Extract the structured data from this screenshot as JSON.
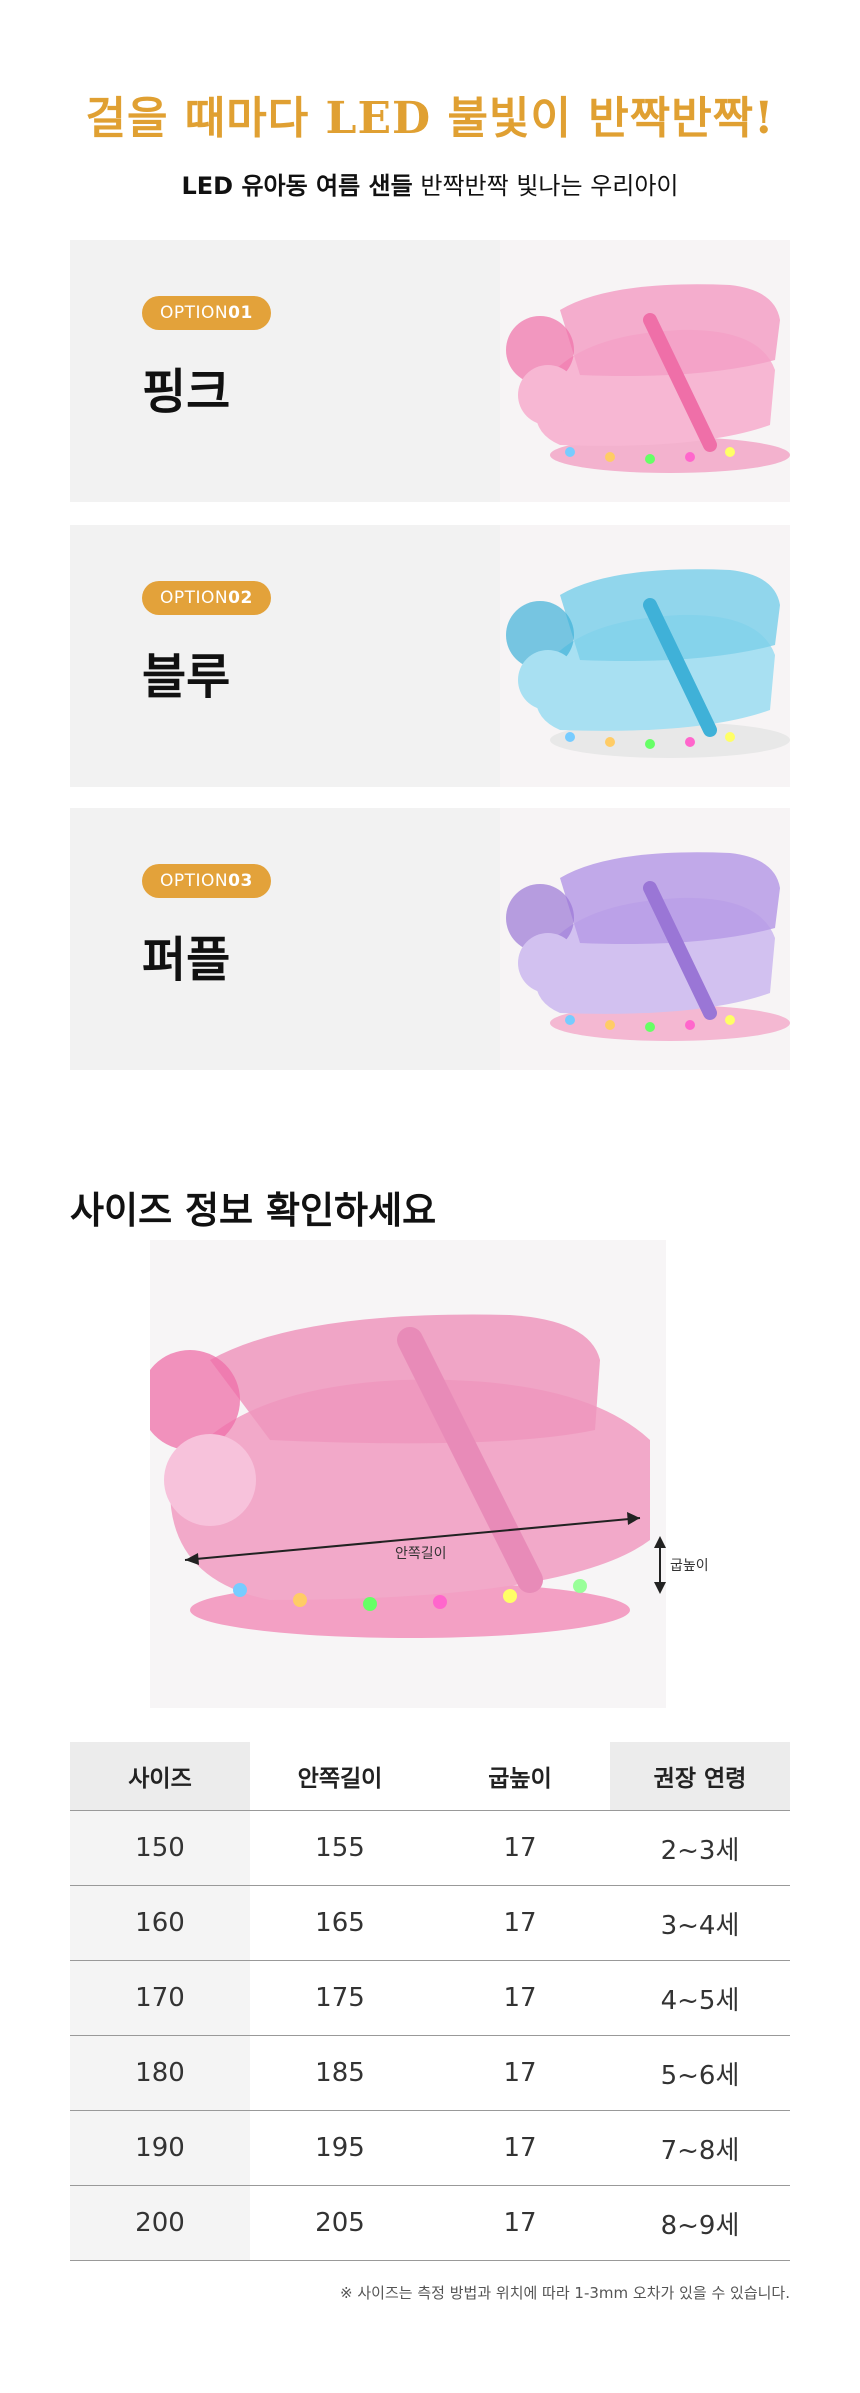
{
  "headline": "걸을 때마다 LED 불빛이 반짝반짝!",
  "subline": {
    "bold": "LED 유아동 여름 샌들",
    "regular": "반짝반짝 빛나는 우리아이"
  },
  "options": [
    {
      "badge_prefix": "OPTION",
      "badge_num": "01",
      "name": "핑크",
      "color": "#ef6fa8",
      "accent": "#f7b7d3"
    },
    {
      "badge_prefix": "OPTION",
      "badge_num": "02",
      "name": "블루",
      "color": "#3fb1d8",
      "accent": "#a8e0f2"
    },
    {
      "badge_prefix": "OPTION",
      "badge_num": "03",
      "name": "퍼플",
      "color": "#9a76d6",
      "accent": "#d2c1f0"
    }
  ],
  "size_section": {
    "title": "사이즈 정보 확인하세요",
    "inner_length_label": "안쪽길이",
    "heel_height_label": "굽높이"
  },
  "size_table": {
    "headers": [
      "사이즈",
      "안쪽길이",
      "굽높이",
      "권장 연령"
    ],
    "rows": [
      [
        "150",
        "155",
        "17",
        "2~3세"
      ],
      [
        "160",
        "165",
        "17",
        "3~4세"
      ],
      [
        "170",
        "175",
        "17",
        "4~5세"
      ],
      [
        "180",
        "185",
        "17",
        "5~6세"
      ],
      [
        "190",
        "195",
        "17",
        "7~8세"
      ],
      [
        "200",
        "205",
        "17",
        "8~9세"
      ]
    ]
  },
  "note": "※ 사이즈는 측정 방법과 위치에 따라 1-3mm 오차가 있을 수 있습니다.",
  "colors": {
    "accent": "#e3a23a",
    "headline": "#e0a032"
  }
}
